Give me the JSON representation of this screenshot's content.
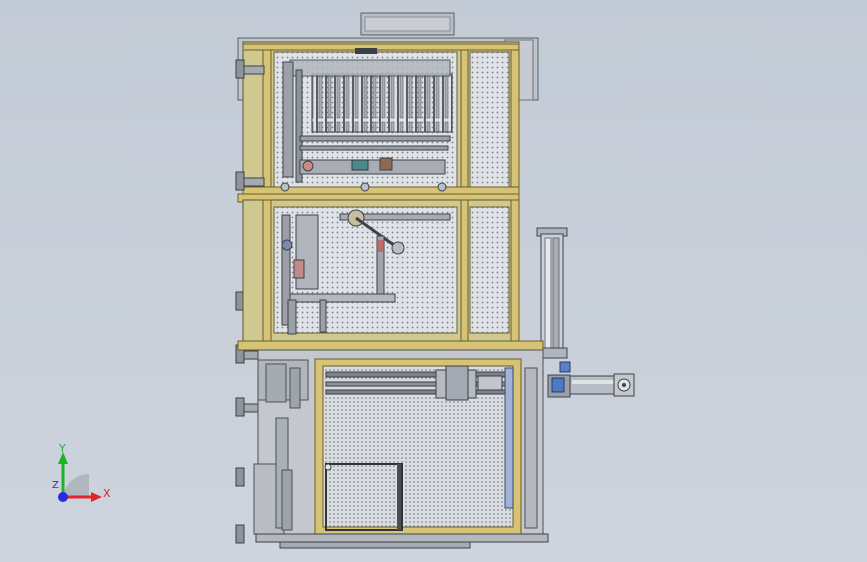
{
  "viewport": {
    "background": [
      "#c3cbd6",
      "#cdd4dd"
    ],
    "description_visible": false
  },
  "triad": {
    "x_label": "X",
    "y_label": "Y",
    "z_label": "Z",
    "x_color": "#e0242a",
    "y_color": "#1db329",
    "z_color": "#2a2ae0"
  },
  "machine": {
    "frame_color": "#d8c47a",
    "frame_edge": "#6b5d2c",
    "mesh_color": "#d9dce1",
    "steel_color": "#b8bcc4",
    "modules": [
      {
        "name": "upper-cabinet",
        "contents": "tool-magazine"
      },
      {
        "name": "middle-cabinet",
        "contents": "pick-arm-mechanism"
      },
      {
        "name": "lower-cabinet",
        "contents": "linear-slide-and-tray"
      }
    ]
  }
}
